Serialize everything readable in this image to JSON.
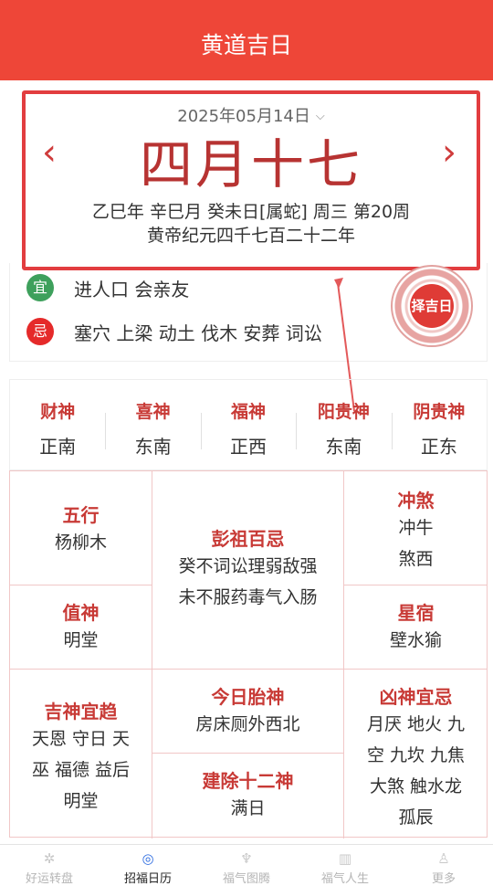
{
  "app": {
    "title": "黄道吉日"
  },
  "date": {
    "selector": "2025年05月14日",
    "lunar": "四月十七",
    "prev": "‹",
    "next": "›",
    "ganzhi": "乙巳年 辛巳月 癸未日[属蛇] 周三 第20周",
    "era": "黄帝纪元四千七百二十二年"
  },
  "yiji": {
    "yi_badge": "宜",
    "yi": "进人口 会亲友",
    "ji_badge": "忌",
    "ji": "塞穴 上梁 动土 伐木 安葬 词讼"
  },
  "seal": {
    "label": "择吉日"
  },
  "gods": [
    {
      "name": "财神",
      "dir": "正南"
    },
    {
      "name": "喜神",
      "dir": "东南"
    },
    {
      "name": "福神",
      "dir": "正西"
    },
    {
      "name": "阳贵神",
      "dir": "东南"
    },
    {
      "name": "阴贵神",
      "dir": "正东"
    }
  ],
  "grid": {
    "wuxing": {
      "h": "五行",
      "t": "杨柳木"
    },
    "pengzu": {
      "h": "彭祖百忌",
      "t1": "癸不词讼理弱敌强",
      "t2": "未不服药毒气入肠"
    },
    "chongsha": {
      "h": "冲煞",
      "t1": "冲牛",
      "t2": "煞西"
    },
    "zhishen": {
      "h": "值神",
      "t": "明堂"
    },
    "xingsu": {
      "h": "星宿",
      "t": "壁水㺄"
    },
    "jishen": {
      "h": "吉神宜趋",
      "t1": "天恩 守日 天",
      "t2": "巫 福德 益后",
      "t3": "明堂"
    },
    "taishen": {
      "h": "今日胎神",
      "t": "房床厕外西北"
    },
    "jianchu": {
      "h": "建除十二神",
      "t": "满日"
    },
    "xiongshen": {
      "h": "凶神宜忌",
      "t1": "月厌 地火 九",
      "t2": "空 九坎 九焦",
      "t3": "大煞 触水龙",
      "t4": "孤辰"
    }
  },
  "nav": [
    {
      "label": "好运转盘",
      "icon": "wheel-icon"
    },
    {
      "label": "招福日历",
      "icon": "calendar-icon"
    },
    {
      "label": "福气图腾",
      "icon": "totem-icon"
    },
    {
      "label": "福气人生",
      "icon": "book-icon"
    },
    {
      "label": "更多",
      "icon": "person-icon"
    }
  ],
  "colors": {
    "header": "#ee4638",
    "accent": "#c83a36",
    "active_tab": "#2f6de0"
  }
}
